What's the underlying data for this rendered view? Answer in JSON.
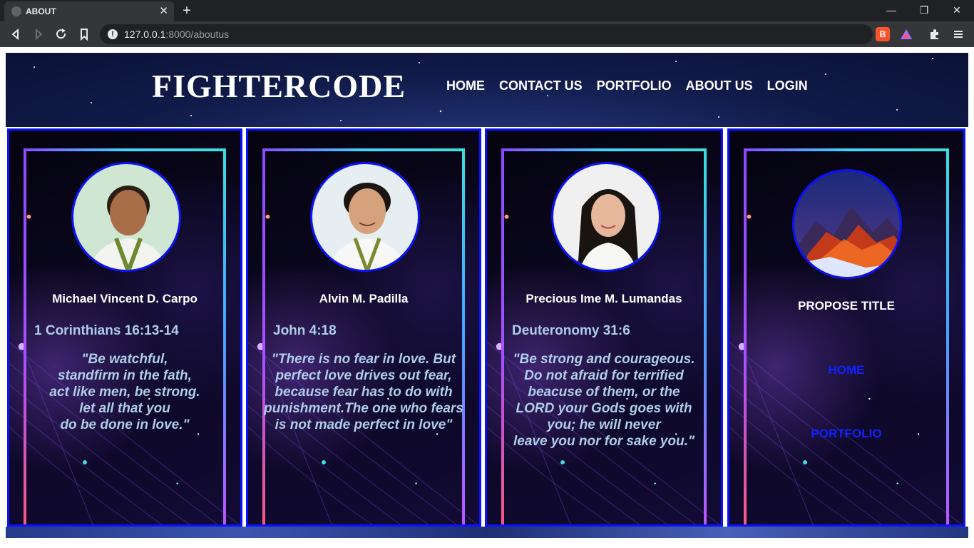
{
  "browser": {
    "tab_title": "ABOUT",
    "new_tab": "+",
    "url_host": "127.0.0.1",
    "url_rest": ":8000/aboutus",
    "brave_label": "B",
    "close_glyph": "✕",
    "minimize_glyph": "—",
    "restore_glyph": "❐",
    "window_close_glyph": "✕"
  },
  "header": {
    "brand": "FIGHTERCODE",
    "nav": [
      "HOME",
      "CONTACT US",
      "PORTFOLIO",
      "ABOUT US",
      "LOGIN"
    ]
  },
  "members": [
    {
      "name": "Michael Vincent D. Carpo",
      "verse_ref": "1 Corinthians 16:13-14",
      "quote": "\"Be watchful,\nstandfirm in the fath,\nact like men, be strong.\nlet all that you\ndo be done in love.\""
    },
    {
      "name": "Alvin M. Padilla",
      "verse_ref": "John 4:18",
      "quote": "\"There is no fear in love. But\nperfect love drives out fear,\nbecause fear has to do with\npunishment.The one who fears\nis not made perfect in love\""
    },
    {
      "name": "Precious Ime M. Lumandas",
      "verse_ref": "Deuteronomy 31:6",
      "quote": "\"Be strong and courageous.\nDo not afraid for terrified\nbeacuse of them, or the\nLORD your Gods goes with\nyou; he will never\nleave you nor for sake you.\""
    }
  ],
  "project": {
    "title": "PROPOSE TITLE",
    "links": [
      "HOME",
      "PORTFOLIO"
    ]
  },
  "colors": {
    "card_border": "#0a12ff",
    "quote_text": "#aecde8",
    "project_link": "#1020ff"
  }
}
